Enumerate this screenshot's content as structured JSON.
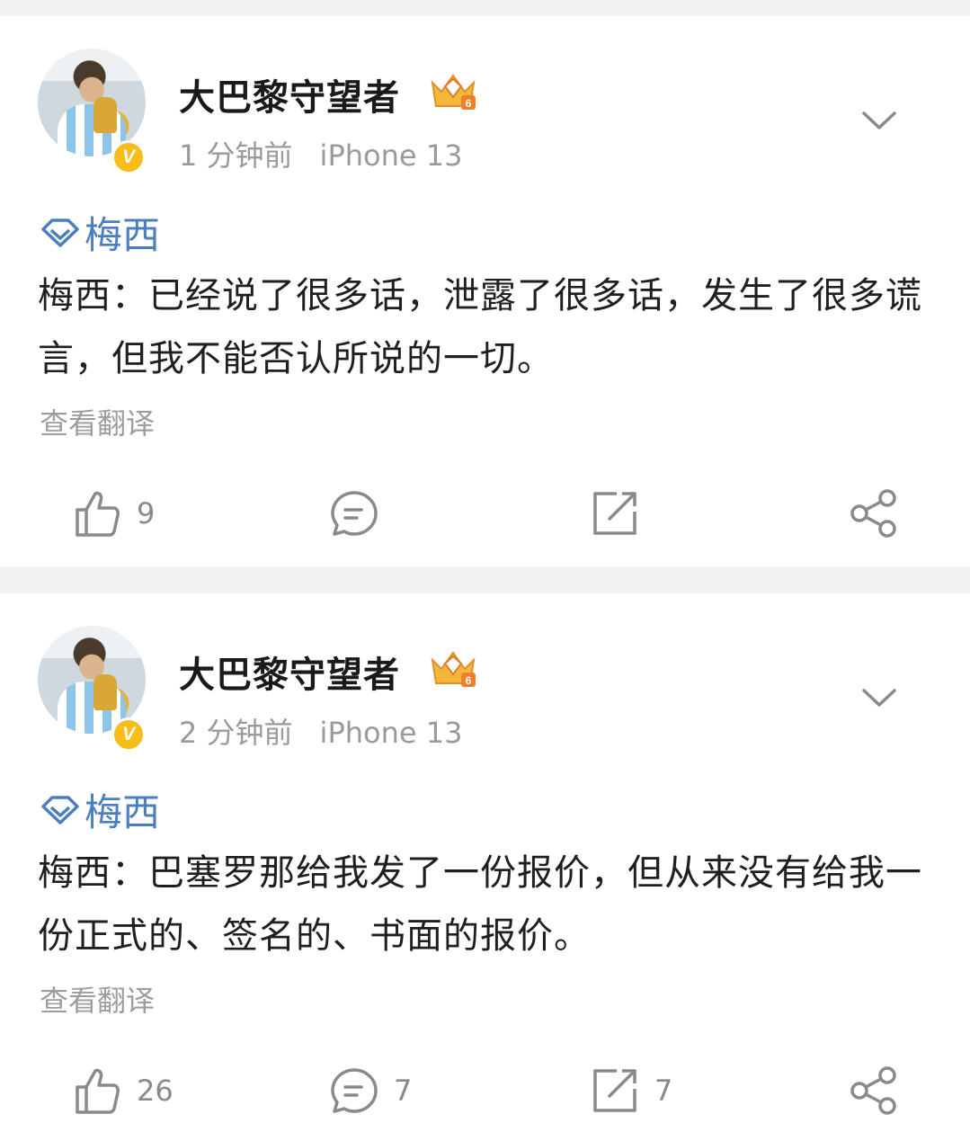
{
  "posts": [
    {
      "username": "大巴黎守望者",
      "time": "1 分钟前",
      "device": "iPhone 13",
      "topic": "梅西",
      "content": "梅西：已经说了很多话，泄露了很多话，发生了很多谎言，但我不能否认所说的一切。",
      "translate": "查看翻译",
      "likes": "9",
      "comments": "",
      "reposts": "",
      "verified_badge": "V"
    },
    {
      "username": "大巴黎守望者",
      "time": "2 分钟前",
      "device": "iPhone 13",
      "topic": "梅西",
      "content": "梅西：巴塞罗那给我发了一份报价，但从来没有给我一份正式的、签名的、书面的报价。",
      "translate": "查看翻译",
      "likes": "26",
      "comments": "7",
      "reposts": "7",
      "verified_badge": "V"
    }
  ],
  "icons": {
    "vip": "crown-badge-icon",
    "more": "chevron-down-icon",
    "topic": "diamond-topic-icon",
    "like": "thumbs-up-icon",
    "comment": "comment-icon",
    "repost": "repost-icon",
    "share": "share-icon"
  },
  "colors": {
    "topic_link": "#4a7fbf",
    "verified": "#f9bd1a",
    "muted": "#9a9a9a"
  }
}
